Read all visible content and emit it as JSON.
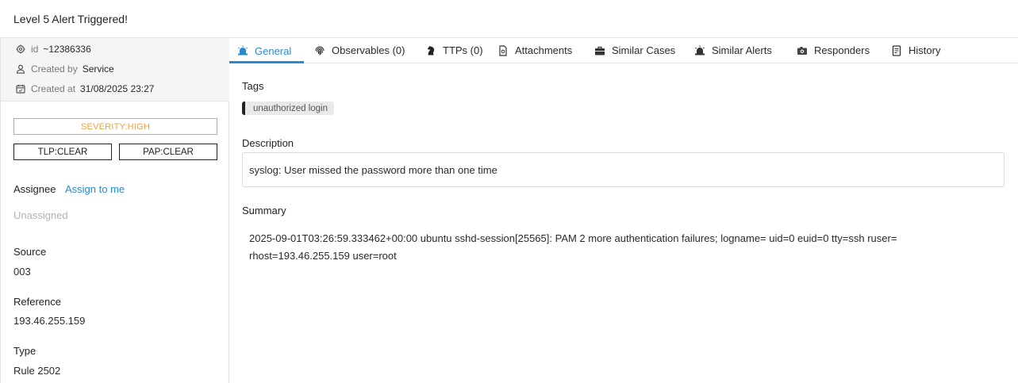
{
  "header": {
    "title": "Level 5 Alert Triggered!"
  },
  "meta": {
    "id_label": "id",
    "id_value": "~12386336",
    "created_by_label": "Created by",
    "created_by_value": "Service",
    "created_at_label": "Created at",
    "created_at_value": "31/08/2025 23:27"
  },
  "badges": {
    "severity": "SEVERITY:HIGH",
    "tlp": "TLP:CLEAR",
    "pap": "PAP:CLEAR",
    "severity_color": "#f0a13a"
  },
  "sidebar": {
    "assignee_label": "Assignee",
    "assign_link": "Assign to me",
    "assignee_value": "Unassigned",
    "source_label": "Source",
    "source_value": "003",
    "reference_label": "Reference",
    "reference_value": "193.46.255.159",
    "type_label": "Type",
    "type_value": "Rule 2502"
  },
  "tabs": [
    {
      "label": "General",
      "icon": "alert-siren-icon",
      "active": true
    },
    {
      "label": "Observables (0)",
      "icon": "fingerprint-icon",
      "active": false
    },
    {
      "label": "TTPs (0)",
      "icon": "chess-knight-icon",
      "active": false
    },
    {
      "label": "Attachments",
      "icon": "file-icon",
      "active": false
    },
    {
      "label": "Similar Cases",
      "icon": "briefcase-icon",
      "active": false
    },
    {
      "label": "Similar Alerts",
      "icon": "alert-siren-icon",
      "active": false
    },
    {
      "label": "Responders",
      "icon": "camera-icon",
      "active": false
    },
    {
      "label": "History",
      "icon": "history-doc-icon",
      "active": false
    }
  ],
  "general": {
    "tags_label": "Tags",
    "tag": "unauthorized login",
    "description_label": "Description",
    "description": "syslog: User missed the password more than one time",
    "summary_label": "Summary",
    "summary_line1": "2025-09-01T03:26:59.333462+00:00 ubuntu sshd-session[25565]: PAM 2 more authentication failures; logname= uid=0 euid=0 tty=ssh ruser=",
    "summary_line2": "rhost=193.46.255.159 user=root"
  },
  "colors": {
    "accent": "#2a8ad1",
    "severity": "#f0a13a"
  }
}
